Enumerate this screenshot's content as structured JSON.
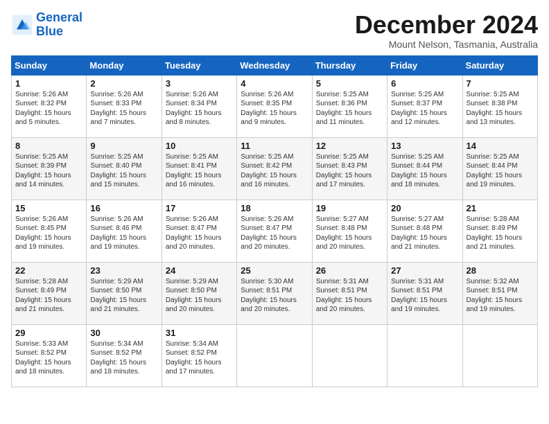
{
  "logo": {
    "line1": "General",
    "line2": "Blue"
  },
  "title": "December 2024",
  "location": "Mount Nelson, Tasmania, Australia",
  "weekdays": [
    "Sunday",
    "Monday",
    "Tuesday",
    "Wednesday",
    "Thursday",
    "Friday",
    "Saturday"
  ],
  "weeks": [
    [
      {
        "day": 1,
        "sunrise": "5:26 AM",
        "sunset": "8:32 PM",
        "daylight": "15 hours and 5 minutes."
      },
      {
        "day": 2,
        "sunrise": "5:26 AM",
        "sunset": "8:33 PM",
        "daylight": "15 hours and 7 minutes."
      },
      {
        "day": 3,
        "sunrise": "5:26 AM",
        "sunset": "8:34 PM",
        "daylight": "15 hours and 8 minutes."
      },
      {
        "day": 4,
        "sunrise": "5:26 AM",
        "sunset": "8:35 PM",
        "daylight": "15 hours and 9 minutes."
      },
      {
        "day": 5,
        "sunrise": "5:25 AM",
        "sunset": "8:36 PM",
        "daylight": "15 hours and 11 minutes."
      },
      {
        "day": 6,
        "sunrise": "5:25 AM",
        "sunset": "8:37 PM",
        "daylight": "15 hours and 12 minutes."
      },
      {
        "day": 7,
        "sunrise": "5:25 AM",
        "sunset": "8:38 PM",
        "daylight": "15 hours and 13 minutes."
      }
    ],
    [
      {
        "day": 8,
        "sunrise": "5:25 AM",
        "sunset": "8:39 PM",
        "daylight": "15 hours and 14 minutes."
      },
      {
        "day": 9,
        "sunrise": "5:25 AM",
        "sunset": "8:40 PM",
        "daylight": "15 hours and 15 minutes."
      },
      {
        "day": 10,
        "sunrise": "5:25 AM",
        "sunset": "8:41 PM",
        "daylight": "15 hours and 16 minutes."
      },
      {
        "day": 11,
        "sunrise": "5:25 AM",
        "sunset": "8:42 PM",
        "daylight": "15 hours and 16 minutes."
      },
      {
        "day": 12,
        "sunrise": "5:25 AM",
        "sunset": "8:43 PM",
        "daylight": "15 hours and 17 minutes."
      },
      {
        "day": 13,
        "sunrise": "5:25 AM",
        "sunset": "8:44 PM",
        "daylight": "15 hours and 18 minutes."
      },
      {
        "day": 14,
        "sunrise": "5:25 AM",
        "sunset": "8:44 PM",
        "daylight": "15 hours and 19 minutes."
      }
    ],
    [
      {
        "day": 15,
        "sunrise": "5:26 AM",
        "sunset": "8:45 PM",
        "daylight": "15 hours and 19 minutes."
      },
      {
        "day": 16,
        "sunrise": "5:26 AM",
        "sunset": "8:46 PM",
        "daylight": "15 hours and 19 minutes."
      },
      {
        "day": 17,
        "sunrise": "5:26 AM",
        "sunset": "8:47 PM",
        "daylight": "15 hours and 20 minutes."
      },
      {
        "day": 18,
        "sunrise": "5:26 AM",
        "sunset": "8:47 PM",
        "daylight": "15 hours and 20 minutes."
      },
      {
        "day": 19,
        "sunrise": "5:27 AM",
        "sunset": "8:48 PM",
        "daylight": "15 hours and 20 minutes."
      },
      {
        "day": 20,
        "sunrise": "5:27 AM",
        "sunset": "8:48 PM",
        "daylight": "15 hours and 21 minutes."
      },
      {
        "day": 21,
        "sunrise": "5:28 AM",
        "sunset": "8:49 PM",
        "daylight": "15 hours and 21 minutes."
      }
    ],
    [
      {
        "day": 22,
        "sunrise": "5:28 AM",
        "sunset": "8:49 PM",
        "daylight": "15 hours and 21 minutes."
      },
      {
        "day": 23,
        "sunrise": "5:29 AM",
        "sunset": "8:50 PM",
        "daylight": "15 hours and 21 minutes."
      },
      {
        "day": 24,
        "sunrise": "5:29 AM",
        "sunset": "8:50 PM",
        "daylight": "15 hours and 20 minutes."
      },
      {
        "day": 25,
        "sunrise": "5:30 AM",
        "sunset": "8:51 PM",
        "daylight": "15 hours and 20 minutes."
      },
      {
        "day": 26,
        "sunrise": "5:31 AM",
        "sunset": "8:51 PM",
        "daylight": "15 hours and 20 minutes."
      },
      {
        "day": 27,
        "sunrise": "5:31 AM",
        "sunset": "8:51 PM",
        "daylight": "15 hours and 19 minutes."
      },
      {
        "day": 28,
        "sunrise": "5:32 AM",
        "sunset": "8:51 PM",
        "daylight": "15 hours and 19 minutes."
      }
    ],
    [
      {
        "day": 29,
        "sunrise": "5:33 AM",
        "sunset": "8:52 PM",
        "daylight": "15 hours and 18 minutes."
      },
      {
        "day": 30,
        "sunrise": "5:34 AM",
        "sunset": "8:52 PM",
        "daylight": "15 hours and 18 minutes."
      },
      {
        "day": 31,
        "sunrise": "5:34 AM",
        "sunset": "8:52 PM",
        "daylight": "15 hours and 17 minutes."
      },
      null,
      null,
      null,
      null
    ]
  ]
}
